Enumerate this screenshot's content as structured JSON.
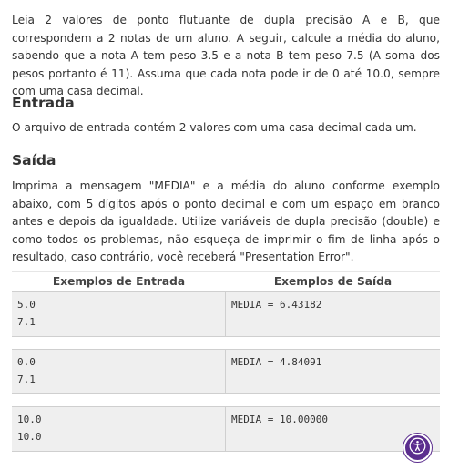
{
  "intro": "Leia 2 valores de ponto flutuante de dupla precisão A e B, que correspondem a 2 notas de um aluno. A seguir, calcule a média do aluno, sabendo que a nota A tem peso 3.5 e a nota B tem peso 7.5 (A soma dos pesos portanto é 11). Assuma que cada nota pode ir de 0 até 10.0, sempre com uma casa decimal.",
  "entrada": {
    "title": "Entrada",
    "text": "O arquivo de entrada contém 2 valores com uma casa decimal cada um."
  },
  "saida": {
    "title": "Saída",
    "text": "Imprima a mensagem \"MEDIA\" e a média do aluno conforme exemplo abaixo, com 5 dígitos após o ponto decimal e com um espaço em branco antes e depois da igualdade. Utilize variáveis de dupla precisão (double) e como todos os problemas, não esqueça de imprimir o fim de linha após o resultado, caso contrário, você receberá \"Presentation Error\"."
  },
  "examples": {
    "header_input": "Exemplos de Entrada",
    "header_output": "Exemplos de Saída",
    "rows": [
      {
        "input": "5.0\n7.1",
        "output": "MEDIA = 6.43182"
      },
      {
        "input": "0.0\n7.1",
        "output": "MEDIA = 4.84091"
      },
      {
        "input": "10.0\n10.0",
        "output": "MEDIA = 10.00000"
      }
    ]
  },
  "accessibility_button": {
    "icon": "accessibility-icon",
    "color": "#5b2d8e"
  }
}
